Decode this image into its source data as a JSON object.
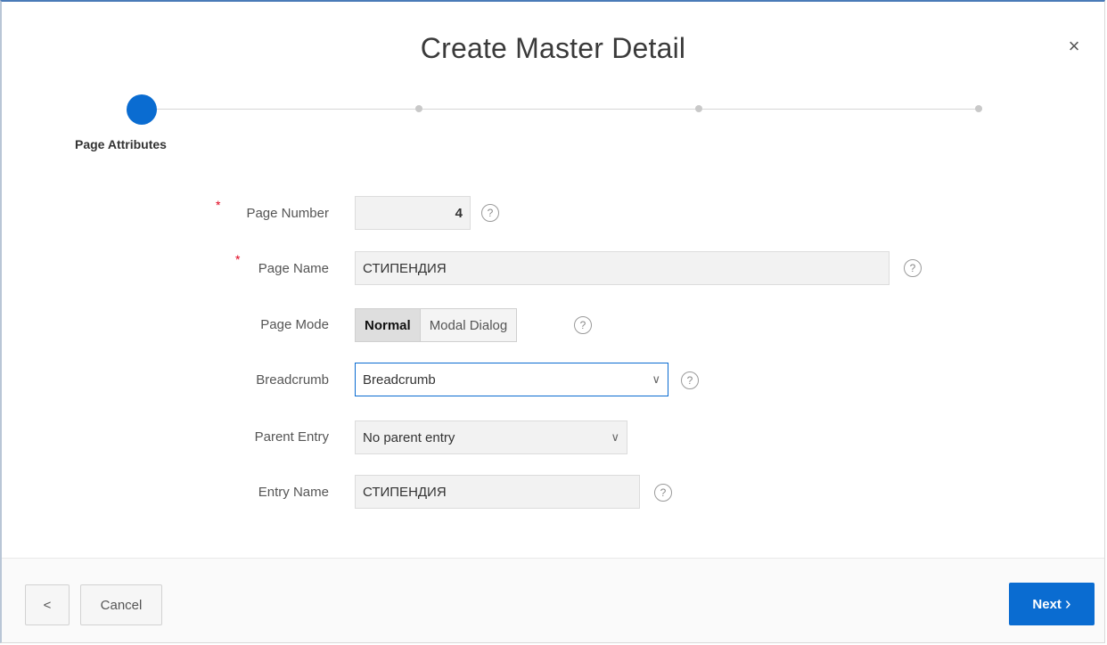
{
  "dialog": {
    "title": "Create Master Detail",
    "close_icon": "×"
  },
  "wizard": {
    "active_step_label": "Page Attributes",
    "total_steps": 4,
    "accent": "#0a6cd1"
  },
  "form": {
    "page_number": {
      "label": "Page Number",
      "value": "4",
      "required": true
    },
    "page_name": {
      "label": "Page Name",
      "value": "СТИПЕНДИЯ",
      "required": true
    },
    "page_mode": {
      "label": "Page Mode",
      "options": [
        "Normal",
        "Modal Dialog"
      ],
      "selected": "Normal"
    },
    "breadcrumb": {
      "label": "Breadcrumb",
      "value": "Breadcrumb"
    },
    "parent_entry": {
      "label": "Parent Entry",
      "value": "No parent entry"
    },
    "entry_name": {
      "label": "Entry Name",
      "value": "СТИПЕНДИЯ"
    },
    "help_glyph": "?",
    "required_glyph": "*"
  },
  "footer": {
    "back_icon": "<",
    "cancel_label": "Cancel",
    "next_label": "Next",
    "next_icon": "›"
  }
}
